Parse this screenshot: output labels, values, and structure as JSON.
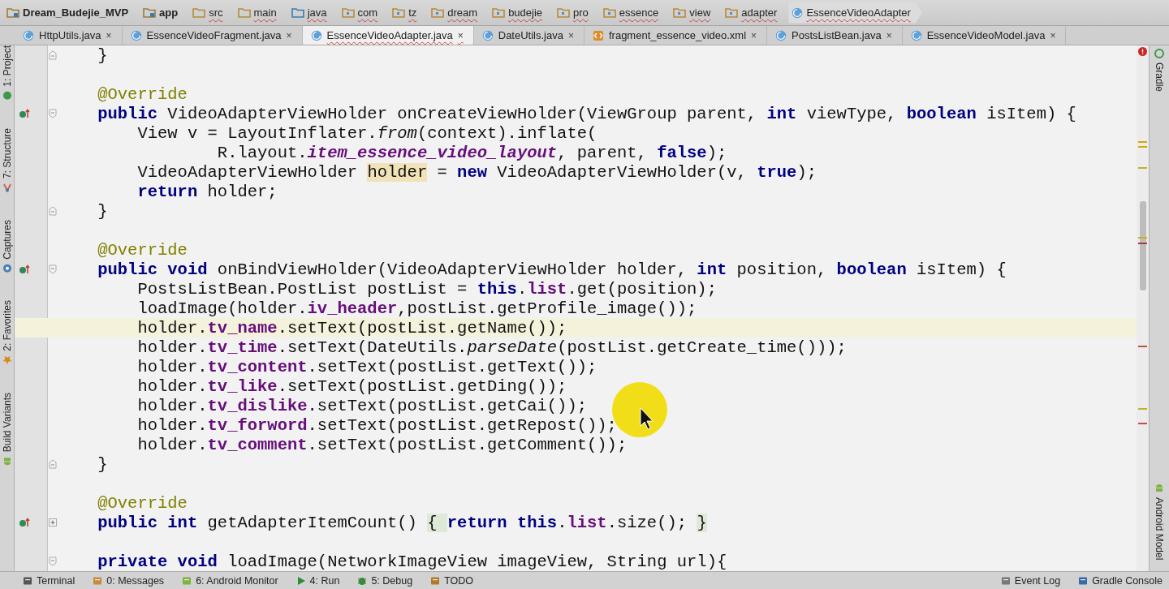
{
  "breadcrumbs": [
    {
      "label": "Dream_Budejie_MVP",
      "kind": "module"
    },
    {
      "label": "app",
      "kind": "module"
    },
    {
      "label": "src",
      "kind": "folder"
    },
    {
      "label": "main",
      "kind": "folder"
    },
    {
      "label": "java",
      "kind": "source"
    },
    {
      "label": "com",
      "kind": "package"
    },
    {
      "label": "tz",
      "kind": "package"
    },
    {
      "label": "dream",
      "kind": "package"
    },
    {
      "label": "budejie",
      "kind": "package"
    },
    {
      "label": "pro",
      "kind": "package"
    },
    {
      "label": "essence",
      "kind": "package"
    },
    {
      "label": "view",
      "kind": "package"
    },
    {
      "label": "adapter",
      "kind": "package"
    },
    {
      "label": "EssenceVideoAdapter",
      "kind": "class"
    }
  ],
  "tabs": [
    {
      "label": "HttpUtils.java",
      "close": "×",
      "kind": "class",
      "selected": false
    },
    {
      "label": "EssenceVideoFragment.java",
      "close": "×",
      "kind": "class",
      "selected": false
    },
    {
      "label": "EssenceVideoAdapter.java",
      "close": "×",
      "kind": "class",
      "selected": true
    },
    {
      "label": "DateUtils.java",
      "close": "×",
      "kind": "class",
      "selected": false
    },
    {
      "label": "fragment_essence_video.xml",
      "close": "×",
      "kind": "xml",
      "selected": false
    },
    {
      "label": "PostsListBean.java",
      "close": "×",
      "kind": "class",
      "selected": false
    },
    {
      "label": "EssenceVideoModel.java",
      "close": "×",
      "kind": "class",
      "selected": false
    }
  ],
  "left_tool_windows": [
    {
      "label": "1: Project",
      "kind": "project"
    },
    {
      "label": "7: Structure",
      "kind": "structure"
    },
    {
      "label": "Captures",
      "kind": "captures"
    },
    {
      "label": "2: Favorites",
      "kind": "favorites"
    },
    {
      "label": "Build Variants",
      "kind": "android"
    }
  ],
  "right_tool_windows": [
    {
      "label": "Gradle",
      "kind": "gradle"
    },
    {
      "label": "Android Model",
      "kind": "android"
    }
  ],
  "code_lines": [
    {
      "kind": "fold-end",
      "current": false,
      "override": false,
      "tokens": [
        {
          "t": "    }",
          "kind": "plain"
        }
      ]
    },
    {
      "kind": "plain"
    },
    {
      "kind": "plain",
      "current": false,
      "override": false,
      "tokens": [
        {
          "t": "    @Override",
          "kind": "annotation"
        }
      ]
    },
    {
      "kind": "fold-start",
      "current": false,
      "override": true,
      "tokens": [
        {
          "t": "    public",
          "kind": "keyword"
        },
        {
          "t": " VideoAdapterViewHolder onCreateViewHolder(ViewGroup parent, ",
          "kind": "plain"
        },
        {
          "t": "int",
          "kind": "keyword"
        },
        {
          "t": " viewType, ",
          "kind": "plain"
        },
        {
          "t": "boolean",
          "kind": "keyword"
        },
        {
          "t": " isItem) {",
          "kind": "plain"
        }
      ]
    },
    {
      "kind": "plain",
      "current": false,
      "override": false,
      "tokens": [
        {
          "t": "        View v = LayoutInflater.",
          "kind": "plain"
        },
        {
          "t": "from",
          "kind": "italic"
        },
        {
          "t": "(context).inflate(",
          "kind": "plain"
        }
      ]
    },
    {
      "kind": "plain",
      "current": false,
      "override": false,
      "tokens": [
        {
          "t": "                R.layout.",
          "kind": "plain"
        },
        {
          "t": "item_essence_video_layout",
          "kind": "static"
        },
        {
          "t": ", parent, ",
          "kind": "plain"
        },
        {
          "t": "false",
          "kind": "keyword"
        },
        {
          "t": ");",
          "kind": "plain"
        }
      ]
    },
    {
      "kind": "plain",
      "current": false,
      "override": false,
      "tokens": [
        {
          "t": "        VideoAdapterViewHolder ",
          "kind": "plain"
        },
        {
          "t": "holder",
          "kind": "usage"
        },
        {
          "t": " = ",
          "kind": "plain"
        },
        {
          "t": "new",
          "kind": "keyword"
        },
        {
          "t": " VideoAdapterViewHolder(v, ",
          "kind": "plain"
        },
        {
          "t": "true",
          "kind": "keyword"
        },
        {
          "t": ");",
          "kind": "plain"
        }
      ]
    },
    {
      "kind": "plain",
      "current": false,
      "override": false,
      "tokens": [
        {
          "t": "        return",
          "kind": "keyword"
        },
        {
          "t": " holder;",
          "kind": "plain"
        }
      ]
    },
    {
      "kind": "fold-end",
      "current": false,
      "override": false,
      "tokens": [
        {
          "t": "    }",
          "kind": "plain"
        }
      ]
    },
    {
      "kind": "plain"
    },
    {
      "kind": "plain",
      "current": false,
      "override": false,
      "tokens": [
        {
          "t": "    @Override",
          "kind": "annotation"
        }
      ]
    },
    {
      "kind": "fold-start",
      "current": false,
      "override": true,
      "tokens": [
        {
          "t": "    public void",
          "kind": "keyword"
        },
        {
          "t": " onBindViewHolder(VideoAdapterViewHolder holder, ",
          "kind": "plain"
        },
        {
          "t": "int",
          "kind": "keyword"
        },
        {
          "t": " position, ",
          "kind": "plain"
        },
        {
          "t": "boolean",
          "kind": "keyword"
        },
        {
          "t": " isItem) {",
          "kind": "plain"
        }
      ]
    },
    {
      "kind": "plain",
      "current": false,
      "override": false,
      "tokens": [
        {
          "t": "        PostsListBean.PostList postList = ",
          "kind": "plain"
        },
        {
          "t": "this",
          "kind": "keyword"
        },
        {
          "t": ".",
          "kind": "plain"
        },
        {
          "t": "list",
          "kind": "field"
        },
        {
          "t": ".get(position);",
          "kind": "plain"
        }
      ]
    },
    {
      "kind": "plain",
      "current": false,
      "override": false,
      "tokens": [
        {
          "t": "        loadImage(holder.",
          "kind": "plain"
        },
        {
          "t": "iv_header",
          "kind": "field"
        },
        {
          "t": ",postList.getProfile_image());",
          "kind": "plain"
        }
      ]
    },
    {
      "kind": "plain",
      "current": true,
      "override": false,
      "tokens": [
        {
          "t": "        holder.",
          "kind": "plain"
        },
        {
          "t": "tv_name",
          "kind": "field"
        },
        {
          "t": ".setText(postList.getName());",
          "kind": "plain"
        }
      ]
    },
    {
      "kind": "plain",
      "current": false,
      "override": false,
      "tokens": [
        {
          "t": "        holder.",
          "kind": "plain"
        },
        {
          "t": "tv_time",
          "kind": "field"
        },
        {
          "t": ".setText(DateUtils.",
          "kind": "plain"
        },
        {
          "t": "parseDate",
          "kind": "italic"
        },
        {
          "t": "(postList.getCreate_time()));",
          "kind": "plain"
        }
      ]
    },
    {
      "kind": "plain",
      "current": false,
      "override": false,
      "tokens": [
        {
          "t": "        holder.",
          "kind": "plain"
        },
        {
          "t": "tv_content",
          "kind": "field"
        },
        {
          "t": ".setText(postList.getText());",
          "kind": "plain"
        }
      ]
    },
    {
      "kind": "plain",
      "current": false,
      "override": false,
      "tokens": [
        {
          "t": "        holder.",
          "kind": "plain"
        },
        {
          "t": "tv_like",
          "kind": "field"
        },
        {
          "t": ".setText(postList.getDing());",
          "kind": "plain"
        }
      ]
    },
    {
      "kind": "plain",
      "current": false,
      "override": false,
      "tokens": [
        {
          "t": "        holder.",
          "kind": "plain"
        },
        {
          "t": "tv_dislike",
          "kind": "field"
        },
        {
          "t": ".setText(postList.getCai());",
          "kind": "plain"
        }
      ]
    },
    {
      "kind": "plain",
      "current": false,
      "override": false,
      "tokens": [
        {
          "t": "        holder.",
          "kind": "plain"
        },
        {
          "t": "tv_forword",
          "kind": "field"
        },
        {
          "t": ".setText(postList.getRepost());",
          "kind": "plain"
        }
      ]
    },
    {
      "kind": "plain",
      "current": false,
      "override": false,
      "tokens": [
        {
          "t": "        holder.",
          "kind": "plain"
        },
        {
          "t": "tv_comment",
          "kind": "field"
        },
        {
          "t": ".setText(postList.getComment());",
          "kind": "plain"
        }
      ]
    },
    {
      "kind": "fold-end",
      "current": false,
      "override": false,
      "tokens": [
        {
          "t": "    }",
          "kind": "plain"
        }
      ]
    },
    {
      "kind": "plain"
    },
    {
      "kind": "plain",
      "current": false,
      "override": false,
      "tokens": [
        {
          "t": "    @Override",
          "kind": "annotation"
        }
      ]
    },
    {
      "kind": "fold-collapsed",
      "current": false,
      "override": true,
      "tokens": [
        {
          "t": "    public int",
          "kind": "keyword"
        },
        {
          "t": " getAdapterItemCount() ",
          "kind": "plain"
        },
        {
          "t": "{ ",
          "kind": "folded"
        },
        {
          "t": "return this",
          "kind": "keyword"
        },
        {
          "t": ".",
          "kind": "plain"
        },
        {
          "t": "list",
          "kind": "field"
        },
        {
          "t": ".size(); ",
          "kind": "plain"
        },
        {
          "t": "}",
          "kind": "folded"
        }
      ]
    },
    {
      "kind": "plain"
    },
    {
      "kind": "fold-start",
      "current": false,
      "override": false,
      "tokens": [
        {
          "t": "    private void",
          "kind": "keyword"
        },
        {
          "t": " loadImage(NetworkImageView imageView, String url){",
          "kind": "plain"
        }
      ]
    }
  ],
  "bottom_tools": [
    {
      "label": "Terminal",
      "kind": "terminal"
    },
    {
      "label": "0: Messages",
      "kind": "messages"
    },
    {
      "label": "6: Android Monitor",
      "kind": "android"
    },
    {
      "label": "4: Run",
      "kind": "run"
    },
    {
      "label": "5: Debug",
      "kind": "debug"
    },
    {
      "label": "TODO",
      "kind": "todo"
    }
  ],
  "bottom_tools_right": [
    {
      "label": "Event Log",
      "kind": "log"
    },
    {
      "label": "Gradle Console",
      "kind": "console"
    }
  ]
}
